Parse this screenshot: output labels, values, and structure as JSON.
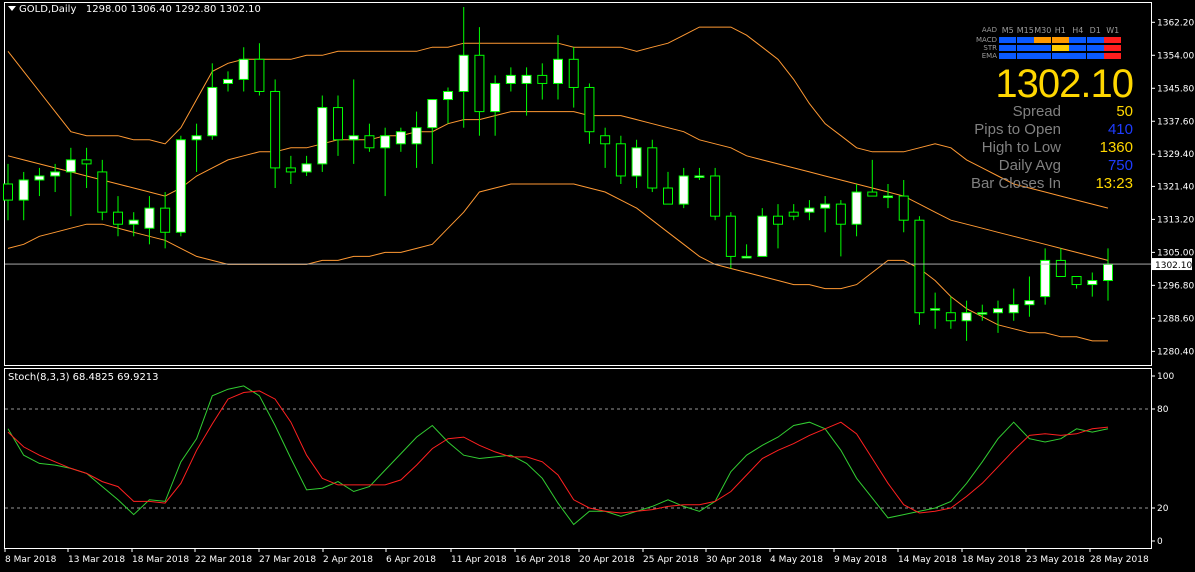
{
  "symbol_header": {
    "symbol": "GOLD,Daily",
    "ohlc": "1298.00 1306.40 1292.80 1302.10"
  },
  "stoch_header": {
    "text": "Stoch(8,3,3) 68.4825 69.9213"
  },
  "current_price_label": "1302.10",
  "info_panel": {
    "big_price": "1302.10",
    "timeframes": [
      "M5",
      "M15",
      "M30",
      "H1",
      "H4",
      "D1",
      "W1"
    ],
    "indicator_rows": [
      {
        "name": "AAD",
        "colors": []
      },
      {
        "name": "MACD",
        "colors": [
          "#0a5aff",
          "#0a5aff",
          "#ff9900",
          "#ff9900",
          "#0a5aff",
          "#0a5aff",
          "#ff1e1e"
        ]
      },
      {
        "name": "STR",
        "colors": [
          "#0a5aff",
          "#0a5aff",
          "#0a5aff",
          "#ffcc00",
          "#0a5aff",
          "#0a5aff",
          "#ff1e1e"
        ]
      },
      {
        "name": "EMA",
        "colors": [
          "#0a5aff",
          "#0a5aff",
          "#0a5aff",
          "#0a5aff",
          "#0a5aff",
          "#0a5aff",
          "#ff1e1e"
        ]
      }
    ],
    "rows": [
      {
        "label": "Spread",
        "value": "50",
        "color": "#ffd700"
      },
      {
        "label": "Pips to Open",
        "value": "410",
        "color": "#1e3cff"
      },
      {
        "label": "High to Low",
        "value": "1360",
        "color": "#ffd700"
      },
      {
        "label": "Daily Avg",
        "value": "750",
        "color": "#1e3cff"
      },
      {
        "label": "Bar Closes In",
        "value": "13:23",
        "color": "#ffd700"
      }
    ]
  },
  "colors": {
    "background": "#000000",
    "bull_fill": "#ffffff",
    "wick": "#00ff00",
    "bands": "#ff9933",
    "axis": "#ffffff",
    "stoch_main": "#32cd32",
    "stoch_signal": "#ff2020"
  },
  "chart_data": [
    {
      "type": "candlestick",
      "title": "GOLD,Daily",
      "ylim": [
        1277,
        1367
      ],
      "y_ticks": [
        "1362.20",
        "1354.00",
        "1345.80",
        "1337.60",
        "1329.40",
        "1321.40",
        "1313.20",
        "1305.00",
        "1296.80",
        "1288.60",
        "1280.40"
      ],
      "x_ticks": [
        "8 Mar 2018",
        "13 Mar 2018",
        "18 Mar 2018",
        "22 Mar 2018",
        "27 Mar 2018",
        "2 Apr 2018",
        "6 Apr 2018",
        "11 Apr 2018",
        "16 Apr 2018",
        "20 Apr 2018",
        "25 Apr 2018",
        "30 Apr 2018",
        "4 May 2018",
        "9 May 2018",
        "14 May 2018",
        "18 May 2018",
        "23 May 2018",
        "28 May 2018"
      ],
      "current_price": 1302.1,
      "candles": [
        {
          "o": 1322,
          "h": 1327,
          "l": 1313,
          "c": 1318
        },
        {
          "o": 1318,
          "h": 1325,
          "l": 1313,
          "c": 1323
        },
        {
          "o": 1323,
          "h": 1326,
          "l": 1319,
          "c": 1324
        },
        {
          "o": 1324,
          "h": 1327,
          "l": 1320,
          "c": 1325
        },
        {
          "o": 1325,
          "h": 1331,
          "l": 1314,
          "c": 1328
        },
        {
          "o": 1328,
          "h": 1331,
          "l": 1321,
          "c": 1327
        },
        {
          "o": 1325,
          "h": 1328,
          "l": 1313,
          "c": 1315
        },
        {
          "o": 1315,
          "h": 1319,
          "l": 1309,
          "c": 1312
        },
        {
          "o": 1312,
          "h": 1315,
          "l": 1309,
          "c": 1313
        },
        {
          "o": 1311,
          "h": 1319,
          "l": 1307,
          "c": 1316
        },
        {
          "o": 1316,
          "h": 1320,
          "l": 1306,
          "c": 1310
        },
        {
          "o": 1310,
          "h": 1334,
          "l": 1309,
          "c": 1333
        },
        {
          "o": 1333,
          "h": 1337,
          "l": 1325,
          "c": 1334
        },
        {
          "o": 1334,
          "h": 1352,
          "l": 1333,
          "c": 1346
        },
        {
          "o": 1347,
          "h": 1350,
          "l": 1345,
          "c": 1348
        },
        {
          "o": 1348,
          "h": 1356,
          "l": 1345,
          "c": 1353
        },
        {
          "o": 1353,
          "h": 1357,
          "l": 1344,
          "c": 1345
        },
        {
          "o": 1345,
          "h": 1348,
          "l": 1321,
          "c": 1326
        },
        {
          "o": 1326,
          "h": 1329,
          "l": 1322,
          "c": 1325
        },
        {
          "o": 1325,
          "h": 1329,
          "l": 1324,
          "c": 1327
        },
        {
          "o": 1327,
          "h": 1344,
          "l": 1325,
          "c": 1341
        },
        {
          "o": 1341,
          "h": 1344,
          "l": 1329,
          "c": 1333
        },
        {
          "o": 1333,
          "h": 1348,
          "l": 1327,
          "c": 1334
        },
        {
          "o": 1334,
          "h": 1337,
          "l": 1330,
          "c": 1331
        },
        {
          "o": 1331,
          "h": 1336,
          "l": 1319,
          "c": 1334
        },
        {
          "o": 1332,
          "h": 1336,
          "l": 1330,
          "c": 1335
        },
        {
          "o": 1332,
          "h": 1340,
          "l": 1326,
          "c": 1336
        },
        {
          "o": 1336,
          "h": 1342,
          "l": 1327,
          "c": 1343
        },
        {
          "o": 1343,
          "h": 1346,
          "l": 1337,
          "c": 1345
        },
        {
          "o": 1345,
          "h": 1366,
          "l": 1336,
          "c": 1354
        },
        {
          "o": 1354,
          "h": 1361,
          "l": 1334,
          "c": 1340
        },
        {
          "o": 1340,
          "h": 1349,
          "l": 1334,
          "c": 1347
        },
        {
          "o": 1347,
          "h": 1351,
          "l": 1345,
          "c": 1349
        },
        {
          "o": 1347,
          "h": 1351,
          "l": 1339,
          "c": 1349
        },
        {
          "o": 1349,
          "h": 1352,
          "l": 1343,
          "c": 1347
        },
        {
          "o": 1347,
          "h": 1359,
          "l": 1343,
          "c": 1353
        },
        {
          "o": 1353,
          "h": 1356,
          "l": 1341,
          "c": 1346
        },
        {
          "o": 1346,
          "h": 1347,
          "l": 1332,
          "c": 1335
        },
        {
          "o": 1334,
          "h": 1336,
          "l": 1326,
          "c": 1332
        },
        {
          "o": 1332,
          "h": 1334,
          "l": 1322,
          "c": 1324
        },
        {
          "o": 1324,
          "h": 1333,
          "l": 1321,
          "c": 1331
        },
        {
          "o": 1331,
          "h": 1333,
          "l": 1320,
          "c": 1321
        },
        {
          "o": 1321,
          "h": 1325,
          "l": 1317,
          "c": 1317
        },
        {
          "o": 1317,
          "h": 1326,
          "l": 1316,
          "c": 1324
        },
        {
          "o": 1324,
          "h": 1326,
          "l": 1323,
          "c": 1324
        },
        {
          "o": 1324,
          "h": 1326,
          "l": 1313,
          "c": 1314
        },
        {
          "o": 1314,
          "h": 1315,
          "l": 1301,
          "c": 1304
        },
        {
          "o": 1304,
          "h": 1307,
          "l": 1304,
          "c": 1304
        },
        {
          "o": 1304,
          "h": 1316,
          "l": 1304,
          "c": 1314
        },
        {
          "o": 1314,
          "h": 1317,
          "l": 1306,
          "c": 1312
        },
        {
          "o": 1315,
          "h": 1317,
          "l": 1313,
          "c": 1314
        },
        {
          "o": 1315,
          "h": 1318,
          "l": 1313,
          "c": 1316
        },
        {
          "o": 1316,
          "h": 1319,
          "l": 1310,
          "c": 1317
        },
        {
          "o": 1317,
          "h": 1318,
          "l": 1304,
          "c": 1312
        },
        {
          "o": 1312,
          "h": 1322,
          "l": 1309,
          "c": 1320
        },
        {
          "o": 1320,
          "h": 1328,
          "l": 1319,
          "c": 1319
        },
        {
          "o": 1319,
          "h": 1322,
          "l": 1316,
          "c": 1319
        },
        {
          "o": 1319,
          "h": 1323,
          "l": 1310,
          "c": 1313
        },
        {
          "o": 1313,
          "h": 1314,
          "l": 1287,
          "c": 1290
        },
        {
          "o": 1291,
          "h": 1295,
          "l": 1286,
          "c": 1291
        },
        {
          "o": 1290,
          "h": 1294,
          "l": 1286,
          "c": 1288
        },
        {
          "o": 1288,
          "h": 1293,
          "l": 1283,
          "c": 1290
        },
        {
          "o": 1290,
          "h": 1292,
          "l": 1288,
          "c": 1290
        },
        {
          "o": 1290,
          "h": 1293,
          "l": 1285,
          "c": 1291
        },
        {
          "o": 1290,
          "h": 1296,
          "l": 1288,
          "c": 1292
        },
        {
          "o": 1292,
          "h": 1299,
          "l": 1289,
          "c": 1293
        },
        {
          "o": 1294,
          "h": 1306,
          "l": 1292,
          "c": 1303
        },
        {
          "o": 1303,
          "h": 1306,
          "l": 1300,
          "c": 1299
        },
        {
          "o": 1299,
          "h": 1299,
          "l": 1296,
          "c": 1297
        },
        {
          "o": 1297,
          "h": 1300,
          "l": 1294,
          "c": 1298
        },
        {
          "o": 1298,
          "h": 1306,
          "l": 1293,
          "c": 1302
        }
      ],
      "bollinger": {
        "upper": [
          1355,
          1350,
          1345,
          1340,
          1335,
          1334,
          1334,
          1334,
          1333,
          1333,
          1332,
          1336,
          1343,
          1350,
          1352,
          1353,
          1353,
          1353,
          1353,
          1354,
          1354,
          1355,
          1355,
          1355,
          1355,
          1355,
          1355,
          1356,
          1356,
          1357,
          1357,
          1357,
          1357,
          1357,
          1357,
          1357,
          1356,
          1356,
          1356,
          1356,
          1355,
          1356,
          1357,
          1359,
          1361,
          1361,
          1361,
          1359,
          1356,
          1353,
          1348,
          1342,
          1337,
          1334,
          1331,
          1330,
          1330,
          1330,
          1331,
          1332,
          1331,
          1328,
          1326,
          1324,
          1322,
          1321,
          1320,
          1319,
          1318,
          1317,
          1316
        ],
        "middle": [
          1329,
          1328,
          1327,
          1326,
          1325,
          1324,
          1323,
          1322,
          1321,
          1320,
          1319,
          1321,
          1324,
          1326,
          1328,
          1329,
          1330,
          1330,
          1331,
          1331,
          1332,
          1333,
          1333,
          1333,
          1334,
          1334,
          1335,
          1335,
          1337,
          1338,
          1338,
          1339,
          1340,
          1340,
          1340,
          1340,
          1340,
          1339,
          1339,
          1339,
          1338,
          1337,
          1336,
          1335,
          1333,
          1332,
          1331,
          1329,
          1328,
          1327,
          1326,
          1325,
          1324,
          1323,
          1322,
          1321,
          1320,
          1319,
          1317,
          1315,
          1313,
          1312,
          1311,
          1310,
          1309,
          1308,
          1307,
          1306,
          1305,
          1304,
          1303
        ],
        "lower": [
          1306,
          1307,
          1309,
          1310,
          1311,
          1312,
          1312,
          1311,
          1310,
          1309,
          1308,
          1306,
          1304,
          1303,
          1302,
          1302,
          1302,
          1302,
          1302,
          1302,
          1303,
          1303,
          1304,
          1304,
          1305,
          1305,
          1306,
          1307,
          1311,
          1315,
          1320,
          1321,
          1322,
          1322,
          1322,
          1322,
          1322,
          1321,
          1320,
          1318,
          1316,
          1313,
          1310,
          1307,
          1304,
          1302,
          1301,
          1300,
          1299,
          1298,
          1297,
          1297,
          1296,
          1296,
          1297,
          1300,
          1303,
          1303,
          1301,
          1298,
          1294,
          1291,
          1289,
          1287,
          1286,
          1285,
          1285,
          1284,
          1284,
          1283,
          1283
        ]
      }
    },
    {
      "type": "line",
      "title": "Stoch(8,3,3) 68.4825 69.9213",
      "ylim": [
        0,
        100
      ],
      "y_ticks": [
        "100",
        "80",
        "20",
        "0"
      ],
      "levels": [
        80,
        20
      ],
      "series": [
        {
          "name": "68.4825",
          "values": [
            68,
            52,
            47,
            46,
            44,
            41,
            33,
            25,
            16,
            25,
            24,
            48,
            62,
            88,
            92,
            94,
            88,
            70,
            50,
            31,
            32,
            36,
            30,
            33,
            43,
            53,
            63,
            70,
            60,
            52,
            50,
            51,
            52,
            47,
            38,
            23,
            10,
            18,
            18,
            15,
            18,
            21,
            25,
            21,
            18,
            24,
            42,
            52,
            58,
            63,
            70,
            72,
            68,
            55,
            38,
            26,
            14,
            16,
            18,
            20,
            24,
            35,
            48,
            62,
            72,
            62,
            60,
            62,
            68,
            66,
            68
          ],
          "color": "#32cd32"
        },
        {
          "name": "69.9213",
          "values": [
            66,
            57,
            52,
            48,
            44,
            41,
            36,
            33,
            24,
            24,
            23,
            35,
            55,
            71,
            86,
            90,
            91,
            86,
            72,
            52,
            38,
            34,
            34,
            34,
            34,
            37,
            46,
            56,
            62,
            63,
            58,
            54,
            51,
            51,
            48,
            40,
            25,
            20,
            18,
            17,
            18,
            19,
            21,
            22,
            22,
            24,
            30,
            40,
            50,
            55,
            59,
            64,
            68,
            72,
            65,
            50,
            35,
            22,
            17,
            18,
            20,
            27,
            35,
            45,
            55,
            64,
            65,
            64,
            65,
            68,
            69
          ],
          "color": "#ff2020"
        }
      ]
    }
  ]
}
